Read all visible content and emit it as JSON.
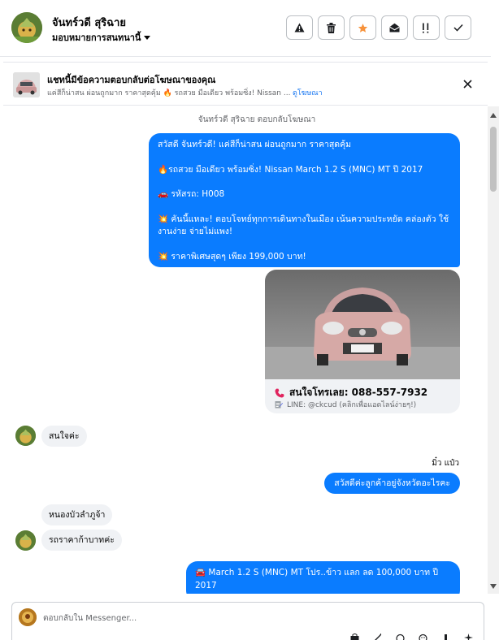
{
  "header": {
    "contact_name": "จันทร์วดี สุริฉาย",
    "assign_label": "มอบหมายการสนทนานี้",
    "action_icons": [
      "warning-icon",
      "trash-icon",
      "star-icon",
      "mail-open-icon",
      "important-icon",
      "check-icon"
    ],
    "star_color": "#f7923b"
  },
  "ad_banner": {
    "title": "แชทนี้มีข้อความตอบกลับต่อโฆษณาของคุณ",
    "subtitle": "แค่สีก็น่าสน ผ่อนถูกมาก ราคาสุดคุ้ม 🔥 รถสวย มือเดียว พร้อมซิ่ง! Nissan ...",
    "link": "ดูโฆษณา"
  },
  "chat": {
    "reply_note": "จันทร์วดี สุริฉาย ตอบกลับโฆษณา",
    "ad_message": {
      "line1": "สวัสดี จันทร์วดี! แค่สีก็น่าสน ผ่อนถูกมาก ราคาสุดคุ้ม",
      "line2": "🔥รถสวย มือเดียว พร้อมซิ่ง! Nissan March 1.2 S (MNC) MT ปี 2017",
      "line3": "🚗 รหัสรถ: H008",
      "line4": "💥 คันนี้แหละ! ตอบโจทย์ทุกการเดินทางในเมือง เน้นความประหยัด คล่องตัว ใช้งานง่าย จ่ายไม่แพง!",
      "line5": "💥 ราคาพิเศษสุดๆ เพียง 199,000 บาท!"
    },
    "card": {
      "call_text": "สนใจโทรเลย: 088-557-7932",
      "line_text": "LINE: @ckcud (คลิกเพื่อแอดไลน์ง่ายๆ!)"
    },
    "incoming_1": "สนใจค่ะ",
    "agent_name": "มิ๋ว แป๋ว",
    "outgoing_1": "สวัสดีค่ะลูกค้าอยู่จังหวัดอะไรคะ",
    "incoming_2": "หนองบัวลำภูจ้า",
    "incoming_3": "รถราคาก้าบาทค่ะ",
    "outgoing_2": "🚘 March 1.2 S (MNC) MT โปร..ข้าว แลก ลด 100,000 บาท ปี 2017"
  },
  "composer": {
    "placeholder": "ตอบกลับใน Messenger..."
  },
  "colors": {
    "accent": "#0a7cff",
    "incoming_bubble": "#f0f2f5",
    "link": "#1877f2"
  }
}
